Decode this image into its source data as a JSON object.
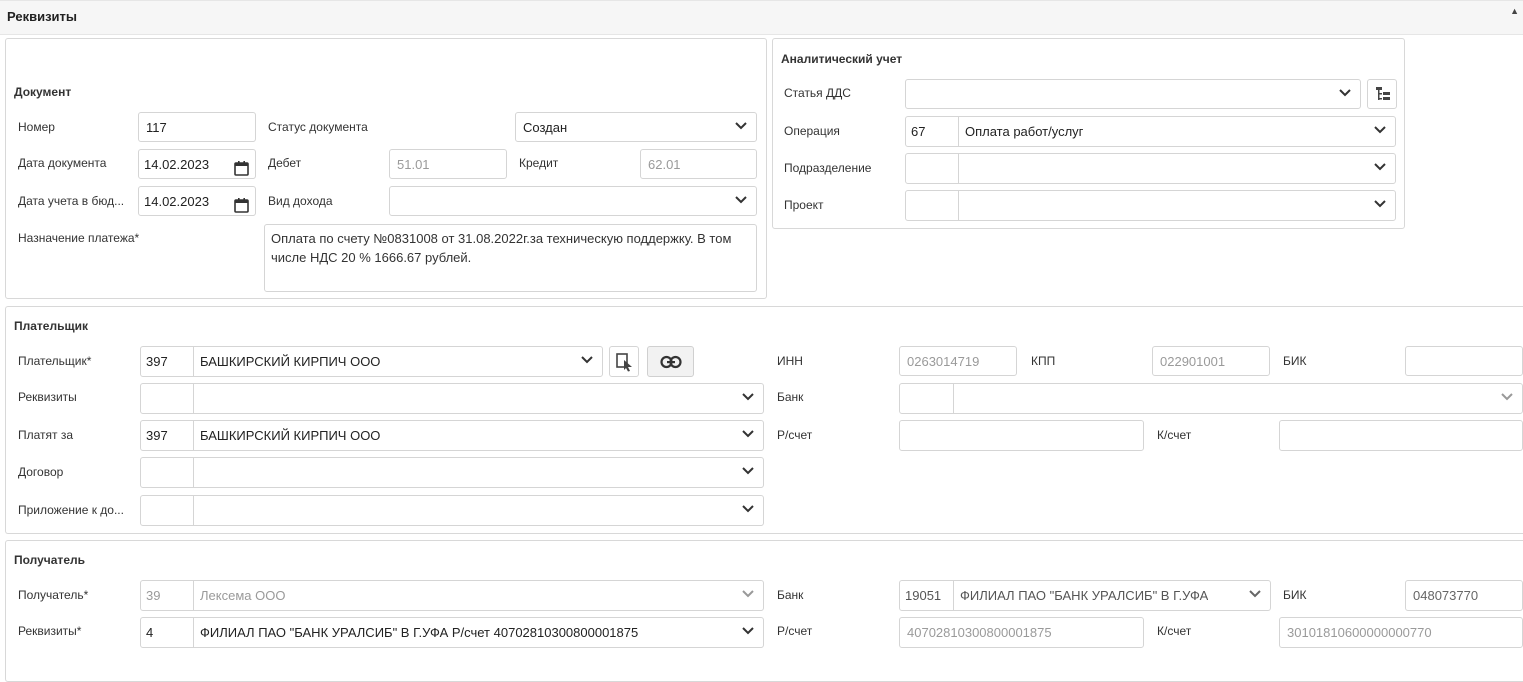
{
  "header": {
    "title": "Реквизиты"
  },
  "document": {
    "title": "Документ",
    "number_label": "Номер",
    "number_value": "117",
    "status_label": "Статус документа",
    "status_value": "Создан",
    "doc_date_label": "Дата документа",
    "doc_date_value": "14.02.2023",
    "debet_label": "Дебет",
    "debet_value": "51.01",
    "credit_label": "Кредит",
    "credit_value": "62.01",
    "budget_date_label": "Дата учета в бюд...",
    "budget_date_value": "14.02.2023",
    "income_type_label": "Вид дохода",
    "income_type_value": "",
    "purpose_label": "Назначение платежа*",
    "purpose_value": "Оплата по счету №0831008 от 31.08.2022г.за техническую поддержку. В том числе НДС 20 %   1666.67 рублей."
  },
  "analytics": {
    "title": "Аналитический учет",
    "dds_label": "Статья ДДС",
    "dds_value": "",
    "operation_label": "Операция",
    "operation_code": "67",
    "operation_value": "Оплата работ/услуг",
    "division_label": "Подразделение",
    "division_code": "",
    "division_value": "",
    "project_label": "Проект",
    "project_code": "",
    "project_value": ""
  },
  "payer": {
    "title": "Плательщик",
    "payer_label": "Плательщик*",
    "payer_code": "397",
    "payer_value": "БАШКИРСКИЙ КИРПИЧ ООО",
    "inn_label": "ИНН",
    "inn_value": "0263014719",
    "kpp_label": "КПП",
    "kpp_value": "022901001",
    "bik_label": "БИК",
    "bik_value": "",
    "requisites_label": "Реквизиты",
    "requisites_code": "",
    "requisites_value": "",
    "bank_label": "Банк",
    "bank_code": "",
    "bank_value": "",
    "pay_for_label": "Платят за",
    "pay_for_code": "397",
    "pay_for_value": "БАШКИРСКИЙ КИРПИЧ ООО",
    "account_label": "Р/счет",
    "account_value": "",
    "corr_label": "К/счет",
    "corr_value": "",
    "contract_label": "Договор",
    "contract_code": "",
    "contract_value": "",
    "attachment_label": "Приложение к до...",
    "attachment_code": "",
    "attachment_value": ""
  },
  "recipient": {
    "title": "Получатель",
    "recipient_label": "Получатель*",
    "recipient_code": "39",
    "recipient_value": "Лексема ООО",
    "bank_label": "Банк",
    "bank_code": "19051",
    "bank_value": "ФИЛИАЛ ПАО \"БАНК УРАЛСИБ\" В Г.УФА",
    "bik_label": "БИК",
    "bik_value": "048073770",
    "requisites_label": "Реквизиты*",
    "requisites_code": "4",
    "requisites_value": "ФИЛИАЛ ПАО \"БАНК УРАЛСИБ\" В Г.УФА Р/счет 40702810300800001875",
    "account_label": "Р/счет",
    "account_value": "40702810300800001875",
    "corr_label": "К/счет",
    "corr_value": "30101810600000000770"
  },
  "icons": {
    "chevron": "chevron-down-icon",
    "calendar": "calendar-icon",
    "tree": "tree-icon",
    "select_cursor": "select-cursor-icon",
    "link": "link-icon",
    "collapse": "collapse-caret-icon"
  },
  "colors": {
    "border": "#d5d5d5",
    "readonly_text": "#9a9a9a",
    "header_bg": "#f6f6f6"
  }
}
